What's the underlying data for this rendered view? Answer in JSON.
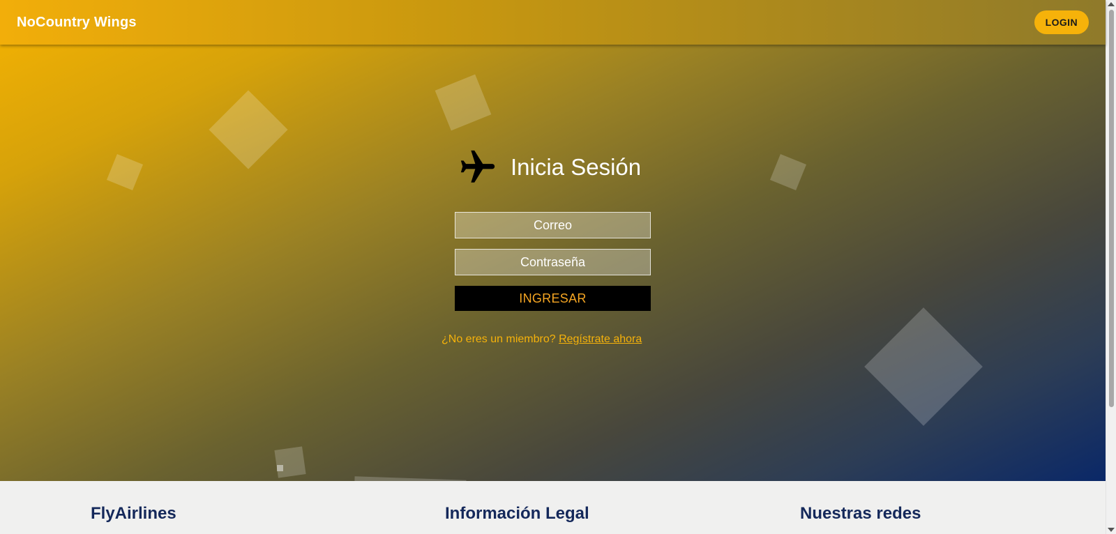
{
  "header": {
    "brand": "NoCountry Wings",
    "login_label": "LOGIN"
  },
  "login_form": {
    "title": "Inicia Sesión",
    "icon": "airplane-icon",
    "email_placeholder": "Correo",
    "password_placeholder": "Contraseña",
    "submit_label": "INGRESAR",
    "register_prompt": "¿No eres un miembro?",
    "register_link": "Regístrate ahora"
  },
  "footer": {
    "columns": [
      {
        "title": "FlyAirlines"
      },
      {
        "title": "Información Legal"
      },
      {
        "title": "Nuestras redes"
      }
    ]
  },
  "colors": {
    "accent": "#f6b20a",
    "gradient_start": "#f6b302",
    "gradient_end": "#0a2868",
    "footer_heading": "#14285a"
  }
}
